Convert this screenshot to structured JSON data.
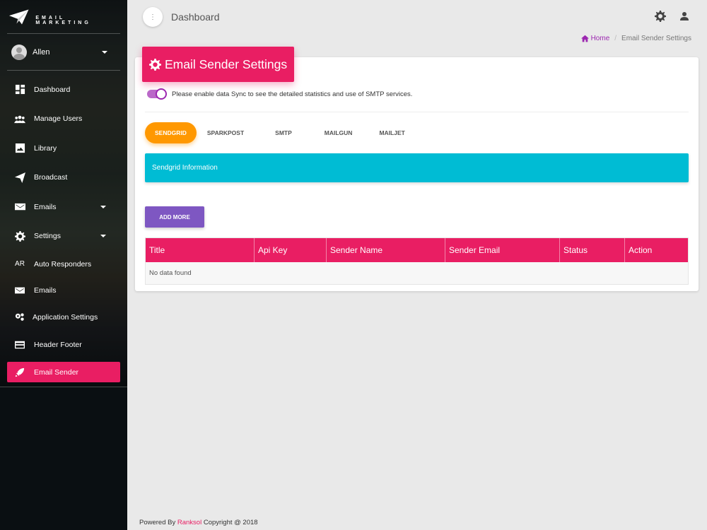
{
  "app": {
    "logo_text": "EMAIL MARKETING",
    "user_name": "Allen"
  },
  "sidebar": {
    "items": [
      {
        "label": "Dashboard",
        "icon": "dashboard-icon"
      },
      {
        "label": "Manage Users",
        "icon": "users-icon"
      },
      {
        "label": "Library",
        "icon": "image-icon"
      },
      {
        "label": "Broadcast",
        "icon": "send-icon"
      },
      {
        "label": "Emails",
        "icon": "mail-icon"
      },
      {
        "label": "Settings",
        "icon": "gear-icon"
      }
    ],
    "sub_items": [
      {
        "label": "Auto Responders",
        "icon_text": "AR"
      },
      {
        "label": "Emails",
        "icon": "mail-icon"
      },
      {
        "label": "Application Settings",
        "icon": "gears-icon"
      },
      {
        "label": "Header Footer",
        "icon": "card-icon"
      },
      {
        "label": "Email Sender",
        "icon": "rocket-icon"
      }
    ]
  },
  "topbar": {
    "title": "Dashboard",
    "menu_icon": "⋮"
  },
  "breadcrumb": {
    "home": "Home",
    "separator": "/",
    "current": "Email Sender Settings"
  },
  "card": {
    "title": "Email Sender Settings",
    "sync_text": "Please enable data Sync to see the detailed statistics and use of SMTP services.",
    "sync_enabled": true,
    "tabs": [
      "SENDGRID",
      "SPARKPOST",
      "SMTP",
      "MAILGUN",
      "MAILJET"
    ],
    "active_tab": "SENDGRID",
    "info_title": "Sendgrid Information",
    "add_button": "ADD MORE",
    "table": {
      "columns": [
        "Title",
        "Api Key",
        "Sender Name",
        "Sender Email",
        "Status",
        "Action"
      ],
      "empty_text": "No data found"
    }
  },
  "footer": {
    "prefix": "Powered By",
    "brand": "Ranksol",
    "suffix": "Copyright @ 2018"
  },
  "colors": {
    "primary": "#e91e63",
    "tab_active": "#ff9800",
    "info": "#00bcd4",
    "button": "#7e57c2",
    "toggle": "#9c27b0"
  }
}
